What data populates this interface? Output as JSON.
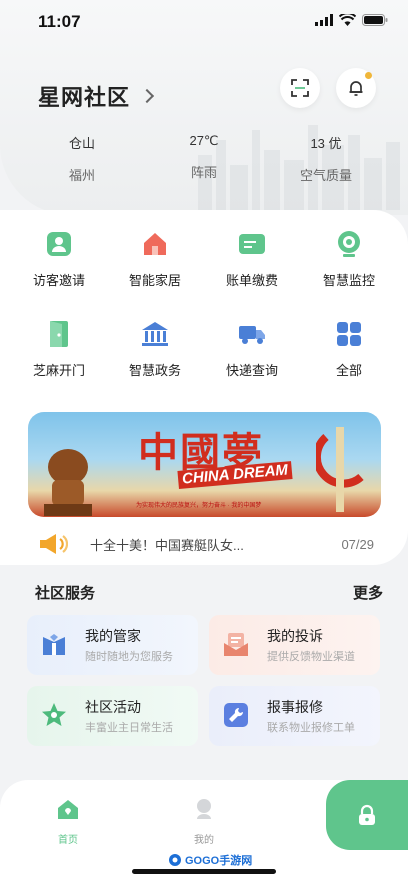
{
  "status": {
    "time": "11:07"
  },
  "header": {
    "community_name": "星网社区"
  },
  "weather": [
    {
      "top": "仓山",
      "bottom": "福州"
    },
    {
      "top": "27℃",
      "bottom": "阵雨"
    },
    {
      "top": "13 优",
      "bottom": "空气质量"
    }
  ],
  "grid": [
    {
      "label": "访客邀请",
      "icon": "visitor-icon"
    },
    {
      "label": "智能家居",
      "icon": "smart-home-icon"
    },
    {
      "label": "账单缴费",
      "icon": "bill-icon"
    },
    {
      "label": "智慧监控",
      "icon": "camera-icon"
    },
    {
      "label": "芝麻开门",
      "icon": "door-icon"
    },
    {
      "label": "智慧政务",
      "icon": "government-icon"
    },
    {
      "label": "快递查询",
      "icon": "delivery-truck-icon"
    },
    {
      "label": "全部",
      "icon": "all-grid-icon"
    }
  ],
  "banner": {
    "title": "中國夢",
    "subtitle": "CHINA DREAM",
    "footer": "为实现伟大的民族复兴，努力奋斗 · 我的中国梦"
  },
  "notice": {
    "text": "十全十美！中国赛艇队女...",
    "date": "07/29"
  },
  "services": {
    "title": "社区服务",
    "more": "更多",
    "items": [
      {
        "title": "我的管家",
        "subtitle": "随时随地为您服务",
        "color": "#eaf1fb",
        "accent": "#4a7fd6"
      },
      {
        "title": "我的投诉",
        "subtitle": "提供反馈物业渠道",
        "color": "#fcefec",
        "accent": "#e8856e"
      },
      {
        "title": "社区活动",
        "subtitle": "丰富业主日常生活",
        "color": "#eaf6ef",
        "accent": "#4dba7c"
      },
      {
        "title": "报事报修",
        "subtitle": "联系物业报修工单",
        "color": "#edf1fb",
        "accent": "#5b7fe0"
      }
    ]
  },
  "tabbar": {
    "home": "首页",
    "mine": "我的"
  },
  "watermark": "GOGO手游网",
  "colors": {
    "brand_green": "#5fc58c"
  }
}
